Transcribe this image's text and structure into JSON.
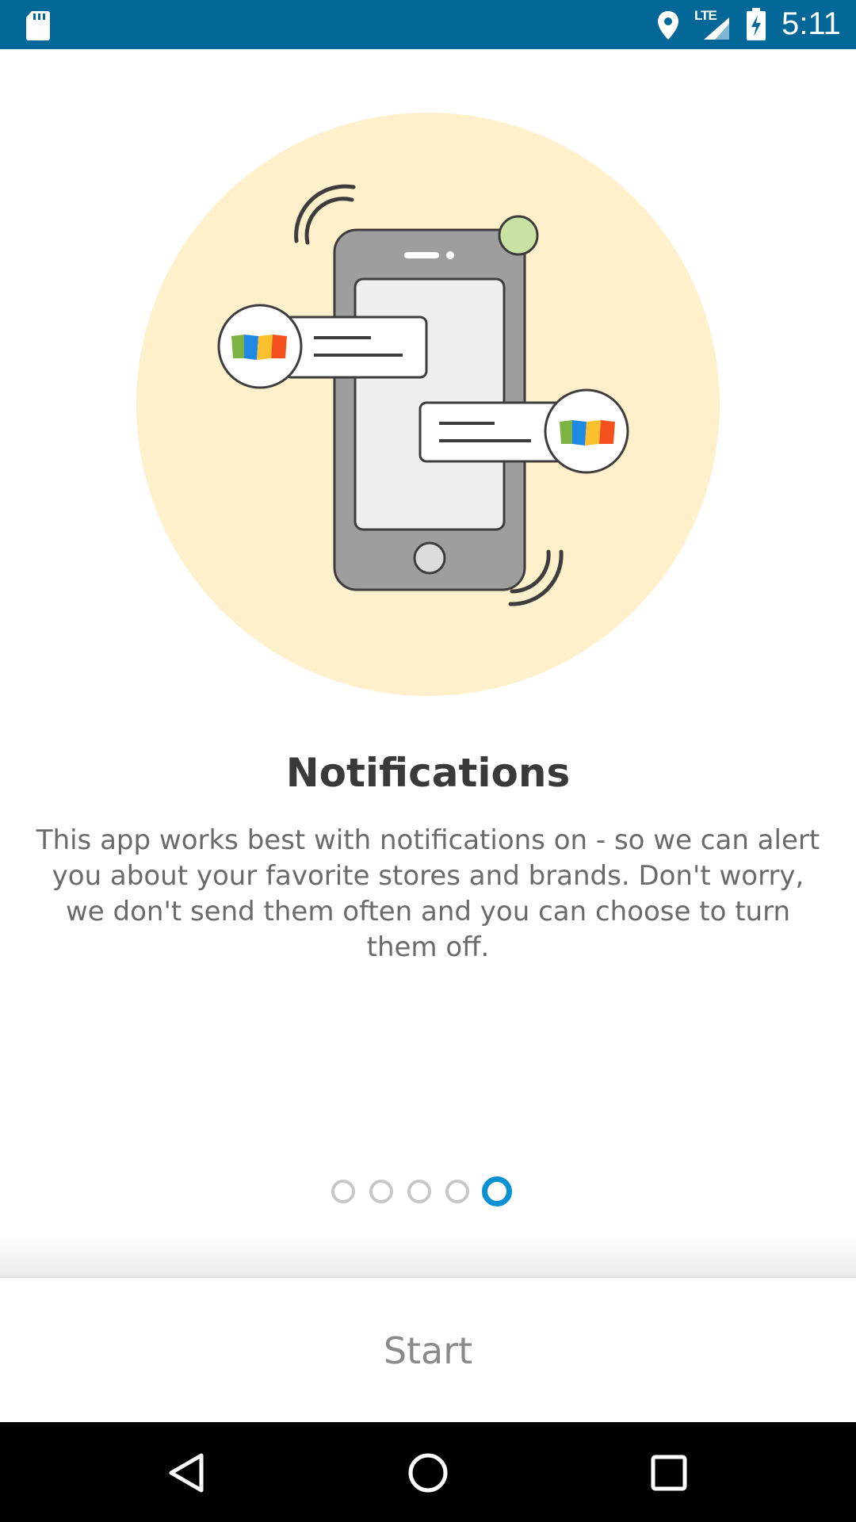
{
  "status_bar": {
    "network_type": "LTE",
    "time": "5:11",
    "icons": [
      "sd-card-icon",
      "location-icon",
      "signal-icon",
      "battery-charging-icon"
    ]
  },
  "onboarding": {
    "title": "Notifications",
    "description": "This app works best with notifications on - so we can alert you about your favorite stores and brands. Don't worry, we don't send them often and you can choose to turn them off.",
    "page_indicator": {
      "total": 5,
      "current": 5
    }
  },
  "start_button": {
    "label": "Start"
  },
  "nav_bar": {
    "buttons": [
      "back-icon",
      "home-icon",
      "recents-icon"
    ]
  },
  "colors": {
    "status_bar": "#036897",
    "accent": "#0a90d4",
    "illustration_bg": "#fdf0cb",
    "phone_body": "#9e9e9e"
  }
}
